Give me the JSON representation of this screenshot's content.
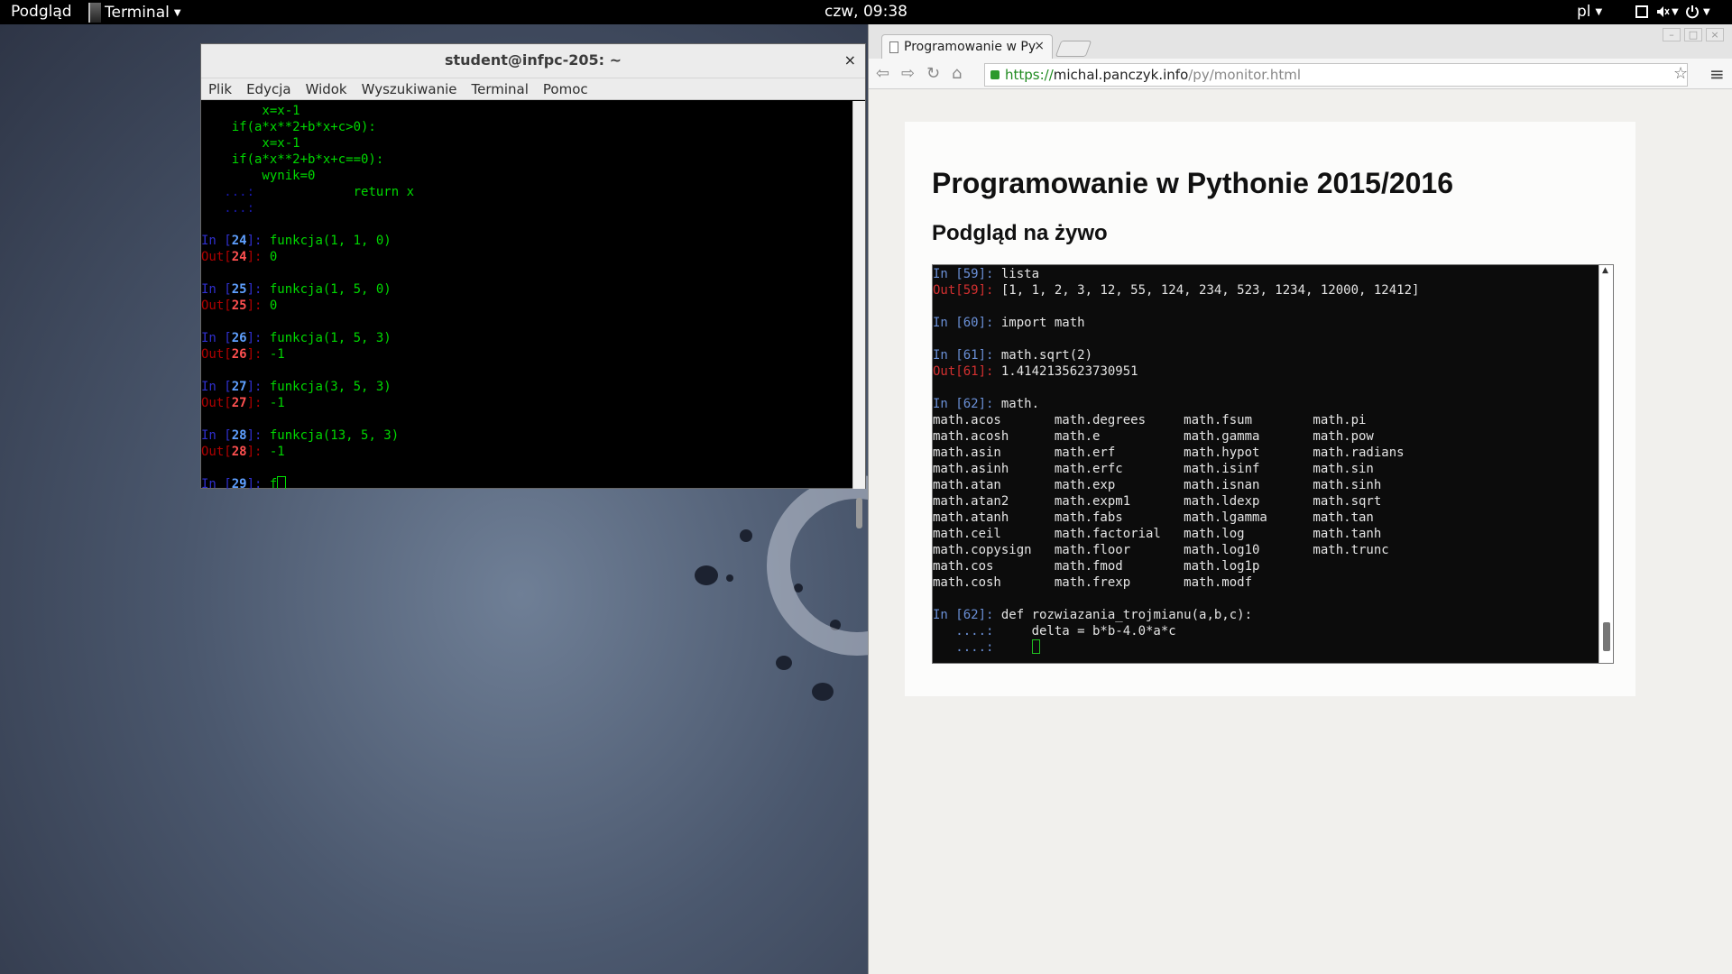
{
  "topbar": {
    "activities": "Podgląd",
    "app_menu": "Terminal",
    "clock": "czw, 09:38",
    "language": "pl"
  },
  "terminal": {
    "title": "student@infpc-205: ~",
    "menu": [
      "Plik",
      "Edycja",
      "Widok",
      "Wyszukiwanie",
      "Terminal",
      "Pomoc"
    ],
    "lines": [
      {
        "t": "code",
        "text": "        x=x-1"
      },
      {
        "t": "code",
        "text": "    if(a*x**2+b*x+c>0):"
      },
      {
        "t": "code",
        "text": "        x=x-1"
      },
      {
        "t": "code",
        "text": "    if(a*x**2+b*x+c==0):"
      },
      {
        "t": "code",
        "text": "        wynik=0"
      },
      {
        "t": "cont",
        "text": "            return x"
      },
      {
        "t": "cont",
        "text": ""
      },
      {
        "t": "blank"
      },
      {
        "t": "in",
        "n": "24",
        "text": "funkcja(1, 1, 0)"
      },
      {
        "t": "out",
        "n": "24",
        "text": "0"
      },
      {
        "t": "blank"
      },
      {
        "t": "in",
        "n": "25",
        "text": "funkcja(1, 5, 0)"
      },
      {
        "t": "out",
        "n": "25",
        "text": "0"
      },
      {
        "t": "blank"
      },
      {
        "t": "in",
        "n": "26",
        "text": "funkcja(1, 5, 3)"
      },
      {
        "t": "out",
        "n": "26",
        "text": "-1"
      },
      {
        "t": "blank"
      },
      {
        "t": "in",
        "n": "27",
        "text": "funkcja(3, 5, 3)"
      },
      {
        "t": "out",
        "n": "27",
        "text": "-1"
      },
      {
        "t": "blank"
      },
      {
        "t": "in",
        "n": "28",
        "text": "funkcja(13, 5, 3)"
      },
      {
        "t": "out",
        "n": "28",
        "text": "-1"
      },
      {
        "t": "blank"
      },
      {
        "t": "in",
        "n": "29",
        "text": "f",
        "cursor": true
      }
    ]
  },
  "browser": {
    "tab_title": "Programowanie w Py",
    "url_scheme": "https://",
    "url_host": "michal.panczyk.info",
    "url_path": "/py/monitor.html",
    "page_title": "Programowanie w Pythonie 2015/2016",
    "page_subtitle": "Podgląd na żywo",
    "console_lines": [
      {
        "t": "in",
        "n": "59",
        "text": "lista"
      },
      {
        "t": "out",
        "n": "59",
        "text": "[1, 1, 2, 3, 12, 55, 124, 234, 523, 1234, 12000, 12412]"
      },
      {
        "t": "blank"
      },
      {
        "t": "in",
        "n": "60",
        "text": "import math"
      },
      {
        "t": "blank"
      },
      {
        "t": "in",
        "n": "61",
        "text": "math.sqrt(2)"
      },
      {
        "t": "out",
        "n": "61",
        "text": "1.4142135623730951"
      },
      {
        "t": "blank"
      },
      {
        "t": "in",
        "n": "62",
        "text": "math."
      },
      {
        "t": "plain",
        "text": "math.acos       math.degrees     math.fsum        math.pi"
      },
      {
        "t": "plain",
        "text": "math.acosh      math.e           math.gamma       math.pow"
      },
      {
        "t": "plain",
        "text": "math.asin       math.erf         math.hypot       math.radians"
      },
      {
        "t": "plain",
        "text": "math.asinh      math.erfc        math.isinf       math.sin"
      },
      {
        "t": "plain",
        "text": "math.atan       math.exp         math.isnan       math.sinh"
      },
      {
        "t": "plain",
        "text": "math.atan2      math.expm1       math.ldexp       math.sqrt"
      },
      {
        "t": "plain",
        "text": "math.atanh      math.fabs        math.lgamma      math.tan"
      },
      {
        "t": "plain",
        "text": "math.ceil       math.factorial   math.log         math.tanh"
      },
      {
        "t": "plain",
        "text": "math.copysign   math.floor       math.log10       math.trunc"
      },
      {
        "t": "plain",
        "text": "math.cos        math.fmod        math.log1p"
      },
      {
        "t": "plain",
        "text": "math.cosh       math.frexp       math.modf"
      },
      {
        "t": "blank"
      },
      {
        "t": "in",
        "n": "62",
        "text": "def rozwiazania_trojmianu(a,b,c):"
      },
      {
        "t": "cont",
        "text": "    delta = b*b-4.0*a*c"
      },
      {
        "t": "cont",
        "text": "    ",
        "cursor": true
      }
    ]
  }
}
